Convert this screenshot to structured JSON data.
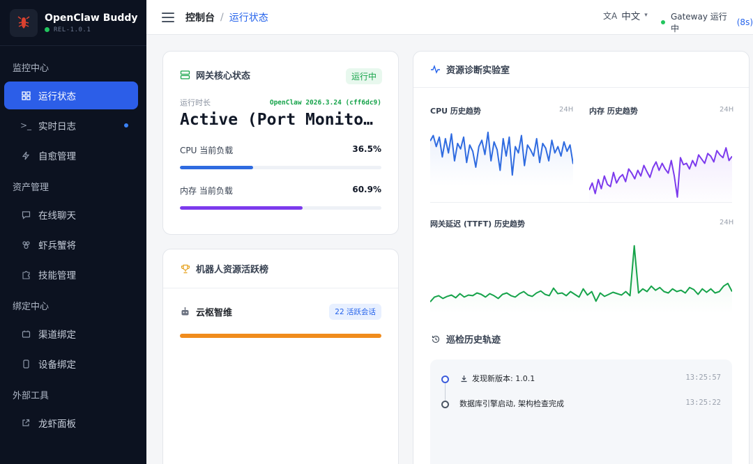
{
  "app": {
    "title": "OpenClaw Buddy",
    "version": "REL-1.0.1"
  },
  "sidebar": {
    "groups": [
      {
        "label": "监控中心",
        "items": [
          {
            "label": "运行状态",
            "icon": "grid-icon"
          },
          {
            "label": "实时日志",
            "icon": "terminal-icon"
          },
          {
            "label": "自愈管理",
            "icon": "bolt-icon"
          }
        ]
      },
      {
        "label": "资产管理",
        "items": [
          {
            "label": "在线聊天",
            "icon": "chat-icon"
          },
          {
            "label": "虾兵蟹将",
            "icon": "bot-icon"
          },
          {
            "label": "技能管理",
            "icon": "puzzle-icon"
          }
        ]
      },
      {
        "label": "绑定中心",
        "items": [
          {
            "label": "渠道绑定",
            "icon": "channel-icon"
          },
          {
            "label": "设备绑定",
            "icon": "phone-icon"
          }
        ]
      },
      {
        "label": "外部工具",
        "items": [
          {
            "label": "龙虾面板",
            "icon": "external-link-icon"
          }
        ]
      }
    ]
  },
  "header": {
    "breadcrumb_root": "控制台",
    "breadcrumb_sep": "/",
    "breadcrumb_current": "运行状态",
    "language": "中文",
    "gateway_text": "Gateway 运行中",
    "gateway_time": "(8s)"
  },
  "gateway_card": {
    "title": "网关核心状态",
    "status_badge": "运行中",
    "uptime_label": "运行时长",
    "version": "OpenClaw 2026.3.24 (cff6dc9)",
    "big_status": "Active (Port Monitoring)",
    "cpu_label": "CPU 当前负载",
    "cpu_value": "36.5%",
    "cpu_fraction": 0.365,
    "mem_label": "内存 当前负载",
    "mem_value": "60.9%",
    "mem_fraction": 0.609
  },
  "rank_card": {
    "title": "机器人资源活跃榜",
    "bot_name": "云枢智维",
    "sessions": "22 活跃会话",
    "bar_fraction": 1.0
  },
  "lab_card": {
    "title": "资源诊断实验室",
    "cpu_chart_label": "CPU 历史趋势",
    "cpu_chart_range": "24H",
    "mem_chart_label": "内存 历史趋势",
    "mem_chart_range": "24H",
    "latency_chart_label": "网关延迟 (TTFT) 历史趋势",
    "latency_chart_range": "24H",
    "history_title": "巡检历史轨迹",
    "history": [
      {
        "text": "发现新版本: 1.0.1",
        "time": "13:25:57",
        "icon": "download-icon"
      },
      {
        "text": "数据库引擎启动, 架构检查完成",
        "time": "13:25:22",
        "icon": ""
      }
    ]
  },
  "colors": {
    "accent": "#2c5ee8",
    "cpu": "#2f6be0",
    "mem": "#7c3aed",
    "latency": "#16a34a",
    "rank": "#f08c1d",
    "sidebar_bg": "#0c1220"
  },
  "chart_data": [
    {
      "type": "line",
      "title": "CPU 历史趋势",
      "values": [
        55,
        62,
        48,
        60,
        35,
        58,
        40,
        64,
        30,
        52,
        45,
        60,
        28,
        50,
        42,
        22,
        48,
        56,
        38,
        66,
        30,
        54,
        44,
        18,
        58,
        36,
        60,
        12,
        48,
        40,
        62,
        24,
        50,
        44,
        36,
        58,
        28,
        52,
        46,
        30,
        56,
        40,
        48,
        36,
        54,
        42,
        50,
        26
      ],
      "ylim": [
        0,
        80
      ]
    },
    {
      "type": "line",
      "title": "内存 历史趋势",
      "values": [
        20,
        30,
        15,
        35,
        22,
        40,
        28,
        25,
        45,
        30,
        38,
        42,
        32,
        50,
        44,
        36,
        48,
        40,
        55,
        46,
        38,
        52,
        60,
        48,
        58,
        50,
        44,
        62,
        40,
        10,
        66,
        56,
        58,
        50,
        62,
        54,
        70,
        64,
        58,
        72,
        68,
        60,
        76,
        70,
        66,
        80,
        62,
        68
      ],
      "ylim": [
        0,
        100
      ]
    },
    {
      "type": "line",
      "title": "网关延迟 (TTFT) 历史趋势",
      "values": [
        15,
        22,
        24,
        20,
        23,
        25,
        21,
        27,
        22,
        25,
        24,
        28,
        26,
        22,
        27,
        24,
        20,
        26,
        28,
        24,
        22,
        27,
        30,
        25,
        23,
        28,
        31,
        26,
        24,
        35,
        27,
        28,
        24,
        30,
        26,
        22,
        34,
        25,
        30,
        16,
        28,
        23,
        26,
        29,
        27,
        25,
        30,
        24,
        97,
        28,
        34,
        30,
        38,
        32,
        36,
        30,
        28,
        34,
        30,
        32,
        28,
        36,
        33,
        26,
        34,
        29,
        34,
        28,
        30,
        38,
        42,
        30
      ],
      "ylim": [
        0,
        110
      ]
    }
  ]
}
